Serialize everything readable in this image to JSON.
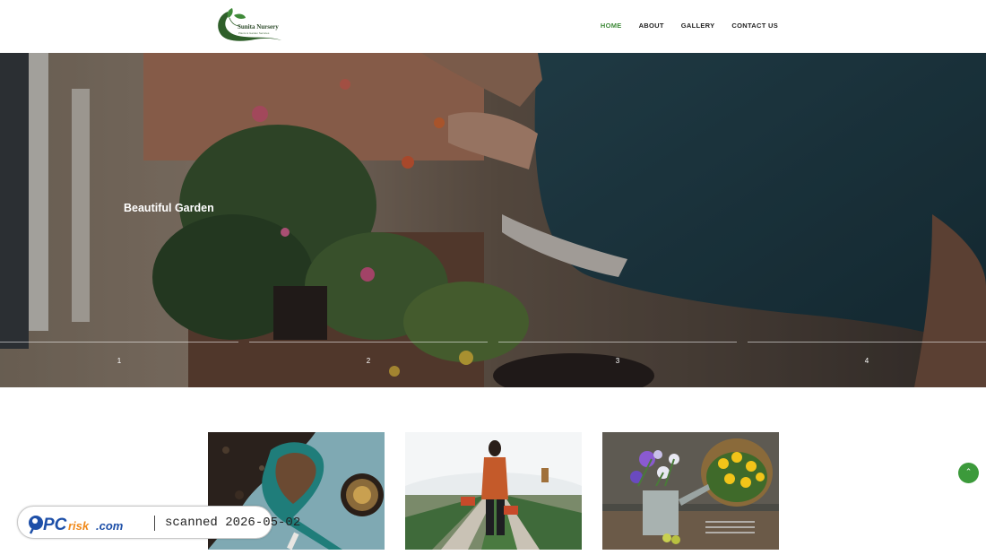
{
  "header": {
    "logo_text": "Sunita Nursery",
    "logo_subtext": "Plants & Garden Services",
    "nav": [
      {
        "label": "HOME",
        "active": true
      },
      {
        "label": "ABOUT",
        "active": false
      },
      {
        "label": "GALLERY",
        "active": false
      },
      {
        "label": "CONTACT US",
        "active": false
      }
    ],
    "active_color": "#3f8a39"
  },
  "hero": {
    "title": "Beautiful Garden",
    "slides": [
      "1",
      "2",
      "3",
      "4"
    ]
  },
  "gallery": {
    "items": [
      "soil-scoop-photo",
      "greenhouse-woman-photo",
      "watering-can-flowers-photo"
    ]
  },
  "back_to_top": {
    "icon": "chevron-up-icon",
    "color": "#3c9a3b"
  },
  "watermark": {
    "brand": "PCrisk.com",
    "text": "scanned 2026-05-02"
  }
}
